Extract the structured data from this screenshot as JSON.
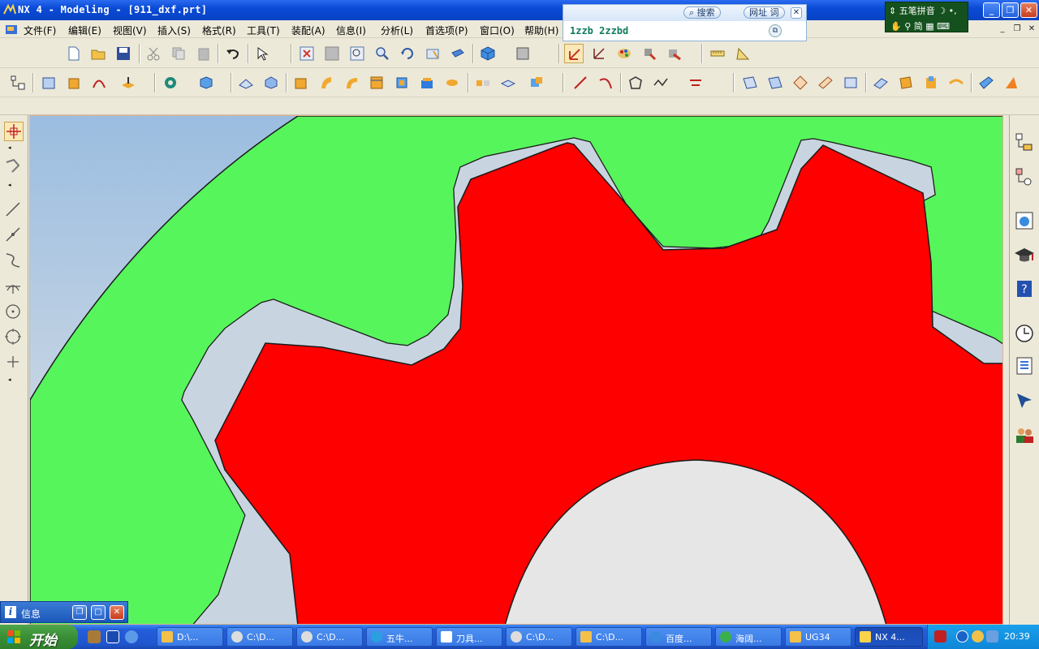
{
  "window": {
    "title": "NX 4 - Modeling - [911_dxf.prt]"
  },
  "menus": [
    {
      "label": "文件(F)"
    },
    {
      "label": "编辑(E)"
    },
    {
      "label": "视图(V)"
    },
    {
      "label": "插入(S)"
    },
    {
      "label": "格式(R)"
    },
    {
      "label": "工具(T)"
    },
    {
      "label": "装配(A)"
    },
    {
      "label": "信息(I)"
    },
    {
      "label": "分析(L)"
    },
    {
      "label": "首选项(P)"
    },
    {
      "label": "窗口(O)"
    },
    {
      "label": "帮助(H)"
    }
  ],
  "search_popup": {
    "search_label": "搜索",
    "url_label": "网址",
    "word_label": "词",
    "input_value": "1zzb 2zzbd"
  },
  "ime": {
    "name": "五笔拼音",
    "mode": "简"
  },
  "toolbar": {
    "start_label": "起始"
  },
  "info_window": {
    "title": "信息"
  },
  "taskbar": {
    "start_label": "开始",
    "tasks": [
      {
        "label": "D:\\..."
      },
      {
        "label": "C:\\D..."
      },
      {
        "label": "C:\\D..."
      },
      {
        "label": "五牛..."
      },
      {
        "label": "刀具..."
      },
      {
        "label": "C:\\D..."
      },
      {
        "label": "C:\\D..."
      },
      {
        "label": "百度..."
      },
      {
        "label": "海阔..."
      },
      {
        "label": "UG34"
      },
      {
        "label": "NX 4..."
      }
    ],
    "clock": "20:39"
  },
  "colors": {
    "green_face": "#57f55c",
    "red_gear": "#ff0000",
    "background_top": "#9bbde0",
    "background_bottom": "#e6e6e6"
  }
}
